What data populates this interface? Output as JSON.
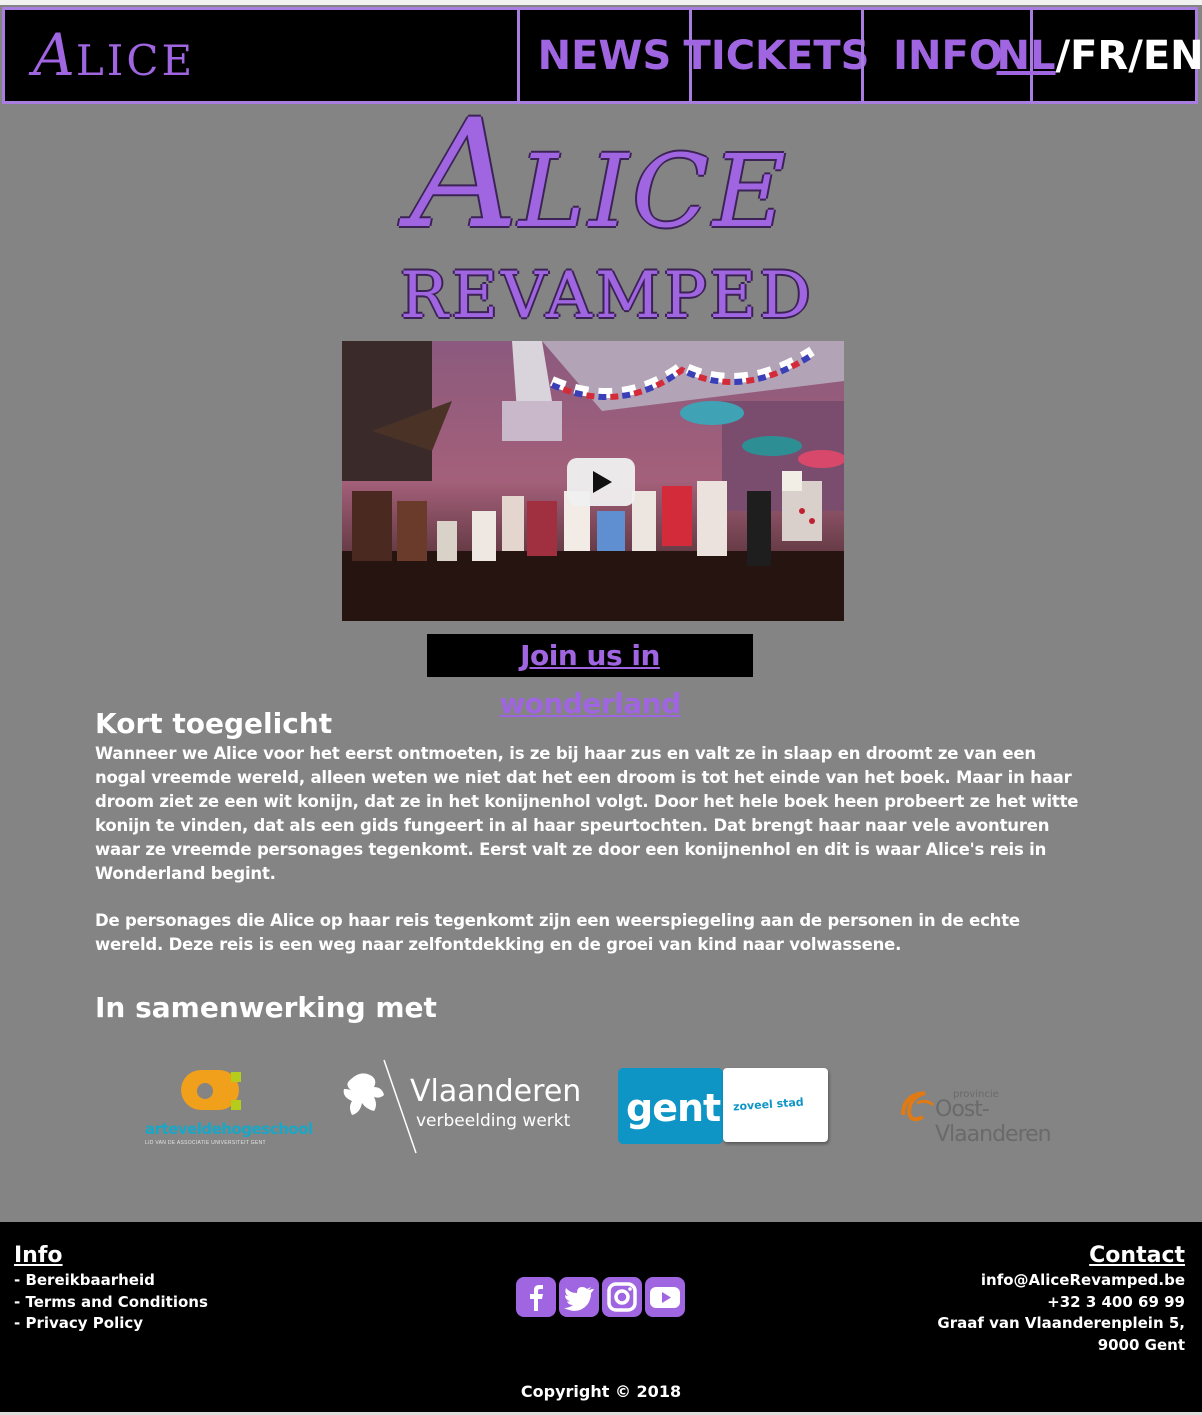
{
  "nav": {
    "logo_first": "A",
    "logo_rest": "LICE",
    "items": [
      {
        "label": "NEWS"
      },
      {
        "label": "TICKETS"
      },
      {
        "label": "INFO"
      }
    ],
    "lang": {
      "nl": "NL",
      "fr": "FR",
      "eng": "ENG",
      "sep": "/"
    }
  },
  "hero": {
    "title_first": "A",
    "title_rest": "LICE",
    "subtitle": "REVAMPED"
  },
  "video": {
    "play_icon": "play-icon"
  },
  "join_link": "Join us in wonderland",
  "intro": {
    "heading": "Kort toegelicht",
    "paragraphs": [
      "Wanneer we Alice voor het eerst ontmoeten, is ze bij haar zus en valt ze in slaap en droomt ze van een nogal vreemde wereld, alleen weten we niet dat het een droom is tot het einde van het boek. Maar in haar droom ziet ze een wit konijn, dat ze in het konijnenhol volgt. Door het hele boek heen probeert ze het witte konijn te vinden, dat als een gids fungeert in al haar speurtochten. Dat brengt haar naar vele avonturen waar ze vreemde personages tegenkomt. Eerst valt ze door een konijnenhol en dit is waar Alice's reis in Wonderland begint.",
      "De personages die Alice op haar reis tegenkomt zijn een weerspiegeling aan de personen in de echte wereld. Deze reis is een weg naar zelfontdekking en de groei van kind naar volwassene."
    ]
  },
  "partners": {
    "heading": "In samenwerking met",
    "artevelde": {
      "name": "arteveldehogeschool",
      "tagline": "LID VAN DE ASSOCIATIE UNIVERSITEIT GENT"
    },
    "vlaanderen": {
      "name": "Vlaanderen",
      "tagline": "verbeelding werkt"
    },
    "gent": {
      "name": "gent:",
      "tagline": "zoveel stad"
    },
    "oost": {
      "small": "provincie",
      "name": "Oost-Vlaanderen"
    }
  },
  "footer": {
    "info_heading": "Info",
    "info_links": [
      "- Bereikbaarheid",
      "- Terms and Conditions",
      "- Privacy Policy"
    ],
    "contact_heading": "Contact",
    "contact_lines": [
      "info@AliceRevamped.be",
      "+32 3 400 69 99",
      "Graaf van Vlaanderenplein 5,",
      "9000 Gent"
    ],
    "social": [
      "facebook-icon",
      "twitter-icon",
      "instagram-icon",
      "youtube-icon"
    ],
    "copyright": "Copyright © 2018"
  },
  "colors": {
    "accent": "#a065e0",
    "background": "#848484",
    "nav": "#000000"
  }
}
